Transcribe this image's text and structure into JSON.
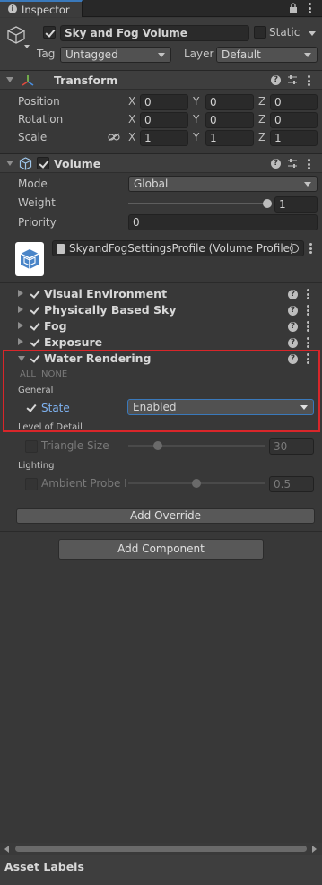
{
  "window": {
    "tab_title": "Inspector",
    "icon": "info-icon"
  },
  "game_object": {
    "name": "Sky and Fog Volume",
    "static_label": "Static",
    "tag_label": "Tag",
    "tag_value": "Untagged",
    "layer_label": "Layer",
    "layer_value": "Default"
  },
  "transform": {
    "title": "Transform",
    "rows": [
      {
        "label": "Position",
        "x": "0",
        "y": "0",
        "z": "0"
      },
      {
        "label": "Rotation",
        "x": "0",
        "y": "0",
        "z": "0"
      },
      {
        "label": "Scale",
        "x": "1",
        "y": "1",
        "z": "1"
      }
    ],
    "axis": {
      "x": "X",
      "y": "Y",
      "z": "Z"
    }
  },
  "volume": {
    "title": "Volume",
    "mode_label": "Mode",
    "mode_value": "Global",
    "weight_label": "Weight",
    "weight_value": "1",
    "weight_fraction": 1.0,
    "priority_label": "Priority",
    "priority_value": "0",
    "profile_value": "SkyandFogSettingsProfile (Volume Profile)"
  },
  "overrides": [
    {
      "label": "Visual Environment",
      "enabled": true,
      "expanded": false
    },
    {
      "label": "Physically Based Sky",
      "enabled": true,
      "expanded": false
    },
    {
      "label": "Fog",
      "enabled": true,
      "expanded": false
    },
    {
      "label": "Exposure",
      "enabled": true,
      "expanded": false
    },
    {
      "label": "Water Rendering",
      "enabled": true,
      "expanded": true
    }
  ],
  "water": {
    "all_label": "ALL",
    "none_label": "NONE",
    "general_label": "General",
    "state_label": "State",
    "state_value": "Enabled",
    "lod_label": "Level of Detail",
    "triangle_label": "Triangle Size",
    "triangle_value": "30",
    "triangle_fraction": 0.2,
    "lighting_label": "Lighting",
    "ambient_label": "Ambient Probe D",
    "ambient_value": "0.5",
    "ambient_fraction": 0.5
  },
  "buttons": {
    "add_override": "Add Override",
    "add_component": "Add Component"
  },
  "footer": {
    "asset_labels": "Asset Labels"
  },
  "colors": {
    "accent_blue": "#3a79bb",
    "highlight_red": "#d9262a",
    "state_label_blue": "#7fb2f0"
  }
}
